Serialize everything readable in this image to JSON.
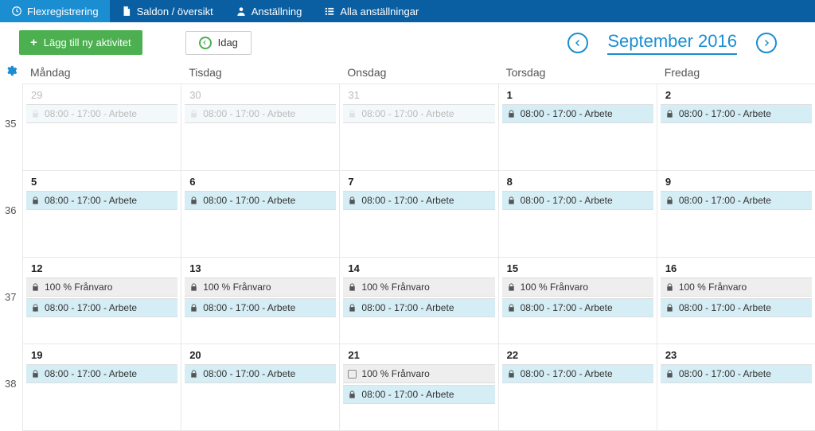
{
  "tabs": {
    "flex": "Flexregistrering",
    "saldon": "Saldon / översikt",
    "anst": "Anställning",
    "alla": "Alla anställningar"
  },
  "toolbar": {
    "add": "Lägg till ny aktivitet",
    "today": "Idag"
  },
  "nav": {
    "month": "September 2016"
  },
  "dayhead": [
    "Måndag",
    "Tisdag",
    "Onsdag",
    "Torsdag",
    "Fredag"
  ],
  "weeks": [
    {
      "num": "35",
      "days": [
        {
          "d": "29",
          "dim": true,
          "entries": [
            {
              "kind": "work",
              "locked": true,
              "dim": true,
              "text": "08:00 - 17:00 - Arbete"
            }
          ]
        },
        {
          "d": "30",
          "dim": true,
          "entries": [
            {
              "kind": "work",
              "locked": true,
              "dim": true,
              "text": "08:00 - 17:00 - Arbete"
            }
          ]
        },
        {
          "d": "31",
          "dim": true,
          "entries": [
            {
              "kind": "work",
              "locked": true,
              "dim": true,
              "text": "08:00 - 17:00 - Arbete"
            }
          ]
        },
        {
          "d": "1",
          "entries": [
            {
              "kind": "work",
              "locked": true,
              "text": "08:00 - 17:00 - Arbete"
            }
          ]
        },
        {
          "d": "2",
          "entries": [
            {
              "kind": "work",
              "locked": true,
              "text": "08:00 - 17:00 - Arbete"
            }
          ]
        }
      ]
    },
    {
      "num": "36",
      "days": [
        {
          "d": "5",
          "entries": [
            {
              "kind": "work",
              "locked": true,
              "text": "08:00 - 17:00 - Arbete"
            }
          ]
        },
        {
          "d": "6",
          "entries": [
            {
              "kind": "work",
              "locked": true,
              "text": "08:00 - 17:00 - Arbete"
            }
          ]
        },
        {
          "d": "7",
          "entries": [
            {
              "kind": "work",
              "locked": true,
              "text": "08:00 - 17:00 - Arbete"
            }
          ]
        },
        {
          "d": "8",
          "entries": [
            {
              "kind": "work",
              "locked": true,
              "text": "08:00 - 17:00 - Arbete"
            }
          ]
        },
        {
          "d": "9",
          "entries": [
            {
              "kind": "work",
              "locked": true,
              "text": "08:00 - 17:00 - Arbete"
            }
          ]
        }
      ]
    },
    {
      "num": "37",
      "days": [
        {
          "d": "12",
          "entries": [
            {
              "kind": "absence",
              "locked": true,
              "text": "100 %  Frånvaro"
            },
            {
              "kind": "work",
              "locked": true,
              "text": "08:00 - 17:00 - Arbete"
            }
          ]
        },
        {
          "d": "13",
          "entries": [
            {
              "kind": "absence",
              "locked": true,
              "text": "100 %  Frånvaro"
            },
            {
              "kind": "work",
              "locked": true,
              "text": "08:00 - 17:00 - Arbete"
            }
          ]
        },
        {
          "d": "14",
          "entries": [
            {
              "kind": "absence",
              "locked": true,
              "text": "100 %  Frånvaro"
            },
            {
              "kind": "work",
              "locked": true,
              "text": "08:00 - 17:00 - Arbete"
            }
          ]
        },
        {
          "d": "15",
          "entries": [
            {
              "kind": "absence",
              "locked": true,
              "text": "100 %  Frånvaro"
            },
            {
              "kind": "work",
              "locked": true,
              "text": "08:00 - 17:00 - Arbete"
            }
          ]
        },
        {
          "d": "16",
          "entries": [
            {
              "kind": "absence",
              "locked": true,
              "text": "100 %  Frånvaro"
            },
            {
              "kind": "work",
              "locked": true,
              "text": "08:00 - 17:00 - Arbete"
            }
          ]
        }
      ]
    },
    {
      "num": "38",
      "days": [
        {
          "d": "19",
          "entries": [
            {
              "kind": "work",
              "locked": true,
              "text": "08:00 - 17:00 - Arbete"
            }
          ]
        },
        {
          "d": "20",
          "entries": [
            {
              "kind": "work",
              "locked": true,
              "text": "08:00 - 17:00 - Arbete"
            }
          ]
        },
        {
          "d": "21",
          "entries": [
            {
              "kind": "absence",
              "locked": false,
              "text": "100 %  Frånvaro"
            },
            {
              "kind": "work",
              "locked": true,
              "text": "08:00 - 17:00 - Arbete"
            }
          ]
        },
        {
          "d": "22",
          "entries": [
            {
              "kind": "work",
              "locked": true,
              "text": "08:00 - 17:00 - Arbete"
            }
          ]
        },
        {
          "d": "23",
          "entries": [
            {
              "kind": "work",
              "locked": true,
              "text": "08:00 - 17:00 - Arbete"
            }
          ]
        }
      ]
    }
  ]
}
